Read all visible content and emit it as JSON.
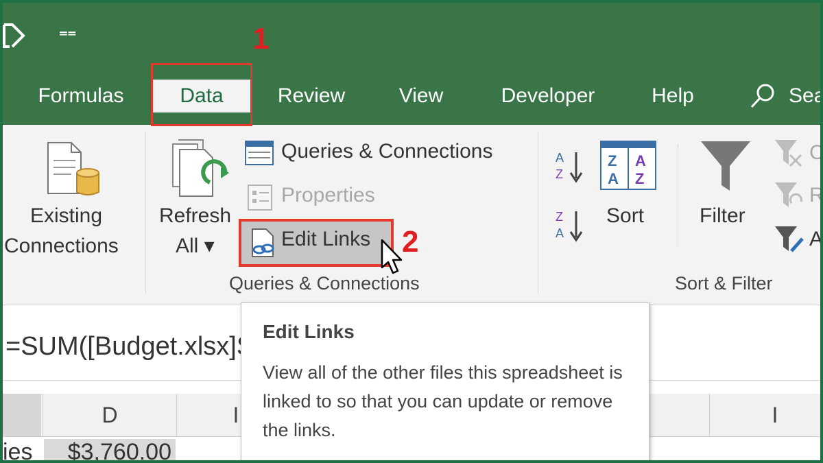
{
  "tabs": [
    {
      "label": "Formulas"
    },
    {
      "label": "Data",
      "active": true
    },
    {
      "label": "Review"
    },
    {
      "label": "View"
    },
    {
      "label": "Developer"
    },
    {
      "label": "Help"
    }
  ],
  "search": {
    "label": "Sea"
  },
  "ribbon": {
    "get_data": {
      "existing_line1": "Existing",
      "existing_line2": "Connections"
    },
    "queries": {
      "refresh_line1": "Refresh",
      "refresh_line2": "All ▾",
      "queries_connections": "Queries & Connections",
      "properties": "Properties",
      "edit_links": "Edit Links",
      "group_label": "Queries & Connections"
    },
    "sort_filter": {
      "sort_az": "A Z",
      "sort_za": "Z A",
      "sort": "Sort",
      "filter": "Filter",
      "clear_partial": "C",
      "reapply_partial": "R",
      "advanced_partial": "A",
      "group_label": "Sort & Filter"
    }
  },
  "formula_bar": {
    "text": "=SUM([Budget.xlsx]Sl"
  },
  "columns": {
    "d": "D",
    "e_partial": "I",
    "h_partial": "I",
    "i": "I"
  },
  "cell": {
    "label_partial": "ies",
    "value": "$3,760.00"
  },
  "tooltip": {
    "title": "Edit Links",
    "body": "View all of the other files this spreadsheet is linked to so that you can update or remove the links."
  },
  "annotations": {
    "step1": "1",
    "step2": "2"
  },
  "colors": {
    "ribbon_green": "#3a7548",
    "frame_green": "#1e7145",
    "callout_red": "#e03b2d"
  }
}
